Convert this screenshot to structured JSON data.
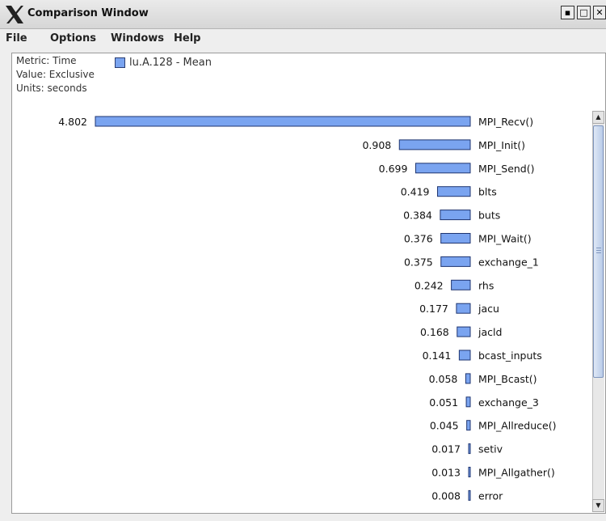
{
  "window": {
    "title": "Comparison Window",
    "buttons": [
      "minimize-button",
      "maximize-button",
      "close-button"
    ]
  },
  "menu": [
    "File",
    "Options",
    "Windows",
    "Help"
  ],
  "info": {
    "metric": "Metric: Time",
    "value": "Value: Exclusive",
    "units": "Units: seconds"
  },
  "legend": {
    "label": "lu.A.128 - Mean",
    "color": "#7aa4f0"
  },
  "chart_data": {
    "type": "bar",
    "orientation": "horizontal",
    "bar_color": "#7aa4f0",
    "series": [
      {
        "name": "lu.A.128 - Mean"
      }
    ],
    "categories": [
      "MPI_Recv()",
      "MPI_Init()",
      "MPI_Send()",
      "blts",
      "buts",
      "MPI_Wait()",
      "exchange_1",
      "rhs",
      "jacu",
      "jacld",
      "bcast_inputs",
      "MPI_Bcast()",
      "exchange_3",
      "MPI_Allreduce()",
      "setiv",
      "MPI_Allgather()",
      "error"
    ],
    "values": [
      4.802,
      0.908,
      0.699,
      0.419,
      0.384,
      0.376,
      0.375,
      0.242,
      0.177,
      0.168,
      0.141,
      0.058,
      0.051,
      0.045,
      0.017,
      0.013,
      0.008
    ],
    "value_labels": [
      "4.802",
      "0.908",
      "0.699",
      "0.419",
      "0.384",
      "0.376",
      "0.375",
      "0.242",
      "0.177",
      "0.168",
      "0.141",
      "0.058",
      "0.051",
      "0.045",
      "0.017",
      "0.013",
      "0.008"
    ]
  }
}
